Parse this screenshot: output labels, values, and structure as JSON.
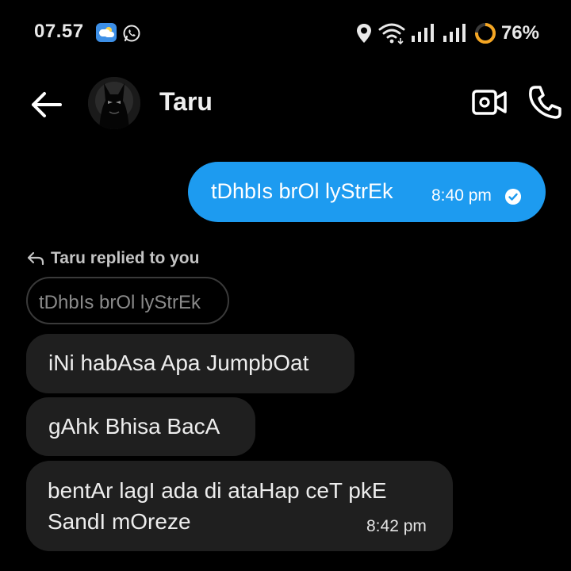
{
  "status_bar": {
    "time": "07.57",
    "battery": "76%",
    "icons": [
      "weather-icon",
      "whatsapp-icon",
      "location-icon",
      "wifi-icon",
      "signal-icon",
      "signal-icon",
      "battery-ring-icon"
    ]
  },
  "header": {
    "contact_name": "Taru",
    "icons": [
      "back-arrow-icon",
      "avatar",
      "video-call-icon",
      "phone-call-icon"
    ]
  },
  "messages": {
    "outgoing": {
      "text": "tDhbIs brOl lyStrEk",
      "time": "8:40 pm",
      "status": "read-check-icon"
    },
    "reply": {
      "label": "Taru replied to you",
      "quoted_text": "tDhbIs brOl lyStrEk"
    },
    "incoming": [
      {
        "text": "iNi habAsa Apa JumpbOat"
      },
      {
        "text": "gAhk Bhisa BacA"
      },
      {
        "line1": "bentAr lagI ada di ataHap ceT pkE",
        "line2": "SandI mOreze",
        "time": "8:42 pm"
      }
    ]
  },
  "colors": {
    "background": "#000000",
    "outgoing_bubble": "#1d9bf0",
    "incoming_bubble": "#1f1f1f",
    "battery_ring": "#f5a623"
  }
}
